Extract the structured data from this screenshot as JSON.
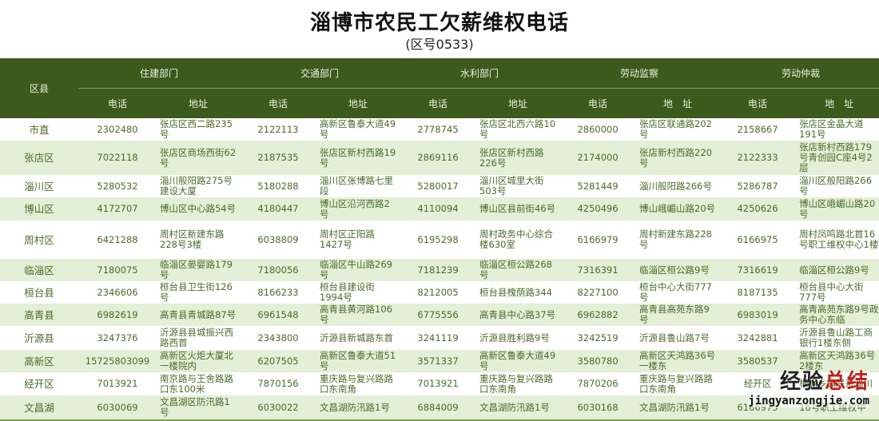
{
  "title": "淄博市农民工欠薪维权电话",
  "subtitle": "(区号0533)",
  "header": {
    "county": "区县",
    "departments": [
      "住建部门",
      "交通部门",
      "水利部门",
      "劳动监察",
      "劳动仲裁"
    ],
    "phone": "电话",
    "address": [
      "地址",
      "地址",
      "地址",
      "地　址",
      "地　址"
    ]
  },
  "rows": [
    {
      "county": "市直",
      "cells": [
        [
          "2302480",
          "张店区西二路235号"
        ],
        [
          "2122113",
          "高新区鲁泰大道49号"
        ],
        [
          "2778745",
          "张店区北西六路10号"
        ],
        [
          "2860000",
          "张店区联通路202号"
        ],
        [
          "2158667",
          "张店区金晶大道191号"
        ]
      ]
    },
    {
      "county": "张店区",
      "cells": [
        [
          "7022118",
          "张店区商场西街62号"
        ],
        [
          "2187535",
          "张店区新村西路19号"
        ],
        [
          "2869116",
          "张店区新村西路226号"
        ],
        [
          "2174000",
          "张店新村西路220号"
        ],
        [
          "2122333",
          "张店新村西路179号青创园C座4号2层"
        ]
      ]
    },
    {
      "county": "淄川区",
      "cells": [
        [
          "5280532",
          "淄川般阳路275号建设大厦"
        ],
        [
          "5180288",
          "淄川区张博路七里段"
        ],
        [
          "5280017",
          "淄川区城里大街503号"
        ],
        [
          "5281449",
          "淄川般阳路266号"
        ],
        [
          "5286787",
          "淄川区般阳路266号"
        ]
      ]
    },
    {
      "county": "博山区",
      "cells": [
        [
          "4172707",
          "博山区中心路54号"
        ],
        [
          "4180447",
          "博山区沿河西路2号"
        ],
        [
          "4110094",
          "博山区县前街46号"
        ],
        [
          "4250496",
          "博山峨嵋山路20号"
        ],
        [
          "4250626",
          "博山区峨嵋山路20号"
        ]
      ]
    },
    {
      "county": "周村区",
      "cells": [
        [
          "6421288",
          "周村区新建东路228号3楼"
        ],
        [
          "6038809",
          "周村区正阳路1427号"
        ],
        [
          "6195298",
          "周村政务中心综合楼630室"
        ],
        [
          "6166979",
          "周村新建东路228号"
        ],
        [
          "6166975",
          "周村凤鸣路北首16号职工维权中心1楼"
        ]
      ]
    },
    {
      "county": "临淄区",
      "cells": [
        [
          "7180075",
          "临淄区晏婴路179号"
        ],
        [
          "7180056",
          "临淄区牛山路269号"
        ],
        [
          "7181239",
          "临淄区桓公路268号"
        ],
        [
          "7316391",
          "临淄区桓公路9号"
        ],
        [
          "7316619",
          "临淄区桓公路9号"
        ]
      ]
    },
    {
      "county": "桓台县",
      "cells": [
        [
          "2346606",
          "桓台县卫生街126号"
        ],
        [
          "8166233",
          "桓台县建设街1994号"
        ],
        [
          "8212005",
          "桓台县槐荫路344"
        ],
        [
          "8227100",
          "桓台中心大街777号"
        ],
        [
          "8187135",
          "桓台县中心大街777号"
        ]
      ]
    },
    {
      "county": "高青县",
      "cells": [
        [
          "6982619",
          "高青县青城路87号"
        ],
        [
          "6961548",
          "高青县黄河路106号"
        ],
        [
          "6775556",
          "高青县中心路37号"
        ],
        [
          "6962882",
          "高青县高苑东路9号"
        ],
        [
          "6983019",
          "高青高苑东路9号政务中心东临"
        ]
      ]
    },
    {
      "county": "沂源县",
      "cells": [
        [
          "3247376",
          "沂源县县城振兴西路西首"
        ],
        [
          "2343800",
          "沂源县新城路东首"
        ],
        [
          "3241119",
          "沂源县胜利路9号"
        ],
        [
          "3242519",
          "沂源县鲁山路7号"
        ],
        [
          "3242881",
          "沂源县鲁山路工商银行1楼东侧"
        ]
      ]
    },
    {
      "county": "高新区",
      "cells": [
        [
          "15725803099",
          "高新区火炬大厦北一楼院内"
        ],
        [
          "6207505",
          "高新区鲁泰大道51号"
        ],
        [
          "3571337",
          "高新区鲁泰大道49号"
        ],
        [
          "3580780",
          "高新区天鸿路36号一楼东"
        ],
        [
          "3580537",
          "高新区天鸿路36号2楼东"
        ]
      ]
    },
    {
      "county": "经开区",
      "cells": [
        [
          "7013921",
          "南京路与王舍路路口东100米"
        ],
        [
          "7870156",
          "重庆路与复兴路路口东南角"
        ],
        [
          "7013921",
          "重庆路与复兴路路口东南角"
        ],
        [
          "7870206",
          "重庆路与复兴路路口东南角"
        ],
        [
          "经开区",
          "根据乡镇联系淄川"
        ]
      ]
    },
    {
      "county": "文昌湖",
      "cells": [
        [
          "6030069",
          "文昌湖区防汛路1号"
        ],
        [
          "6030022",
          "文昌湖防汛路1号"
        ],
        [
          "6884009",
          "文昌湖防汛路1号"
        ],
        [
          "6030168",
          "文昌湖防汛路1号"
        ],
        [
          "6166975",
          "16号职工维权中"
        ]
      ]
    }
  ],
  "watermark": {
    "cn_a": "经验",
    "cn_b": "总结",
    "en": "jingyanzongjie.com"
  }
}
